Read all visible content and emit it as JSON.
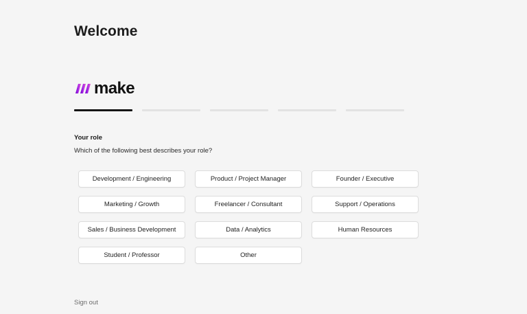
{
  "page": {
    "title": "Welcome"
  },
  "brand": {
    "name": "make",
    "accent_colors": [
      "#6d00cc",
      "#b22ee8",
      "#e35ec7"
    ]
  },
  "progress": {
    "total_steps": 5,
    "current_step": 1
  },
  "role_section": {
    "title": "Your role",
    "question": "Which of the following best describes your role?",
    "options": [
      "Development / Engineering",
      "Product / Project Manager",
      "Founder / Executive",
      "Marketing / Growth",
      "Freelancer / Consultant",
      "Support / Operations",
      "Sales / Business Development",
      "Data / Analytics",
      "Human Resources",
      "Student / Professor",
      "Other"
    ]
  },
  "footer": {
    "sign_out_label": "Sign out"
  }
}
